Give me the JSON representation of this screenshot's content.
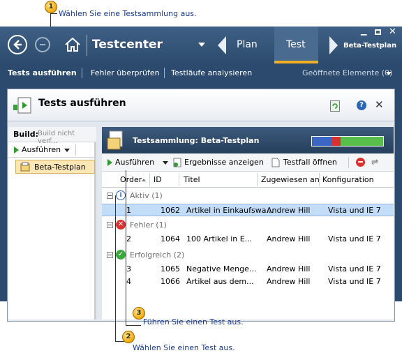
{
  "callouts": [
    {
      "num": "1",
      "text": "Wählen Sie eine Testsammlung aus."
    },
    {
      "num": "2",
      "text": "Wählen Sie einen Test aus."
    },
    {
      "num": "3",
      "text": "Führen Sie einen Test aus."
    }
  ],
  "app": {
    "title": "Testcenter",
    "nav": {
      "plan": "Plan",
      "test": "Test",
      "testplan": "Beta-Testplan"
    },
    "subnav": {
      "run_tests": "Tests ausführen",
      "verify_bugs": "Fehler überprüfen",
      "analyze_runs": "Testläufe analysieren",
      "open_items": "Geöffnete Elemente (0)"
    }
  },
  "panel": {
    "title": "Tests ausführen",
    "left": {
      "build_label": "Build:",
      "build_value": "Build nicht verf...",
      "run_button": "Ausführen",
      "plan_item": "Beta-Testplan"
    },
    "suite": {
      "title": "Testsammlung: Beta-Testplan",
      "progress": {
        "passed": 0.6,
        "failed": 0.13,
        "active": 0.27
      }
    },
    "toolbar": {
      "run": "Ausführen",
      "view_results": "Ergebnisse anzeigen",
      "open_testcase": "Testfall öffnen"
    },
    "columns": [
      "Order",
      "ID",
      "Titel",
      "Zugewiesen an",
      "Konfiguration"
    ],
    "groups": [
      {
        "name": "Aktiv (1)",
        "rows": [
          {
            "order": "1",
            "id": "1062",
            "title": "Artikel in Einkaufswa...",
            "assigned": "Andrew Hill",
            "config": "Vista und IE 7"
          }
        ]
      },
      {
        "name": "Fehler (1)",
        "rows": [
          {
            "order": "2",
            "id": "1064",
            "title": "100 Artikel in E...",
            "assigned": "Andrew Hill",
            "config": "Vista und IE 7"
          }
        ]
      },
      {
        "name": "Erfolgreich (2)",
        "rows": [
          {
            "order": "3",
            "id": "1065",
            "title": "Negative Menge...",
            "assigned": "Andrew Hill",
            "config": "Vista und IE 7"
          },
          {
            "order": "4",
            "id": "1066",
            "title": "Artikel aus dem...",
            "assigned": "Andrew Hill",
            "config": "Vista und IE 7"
          }
        ]
      }
    ]
  }
}
